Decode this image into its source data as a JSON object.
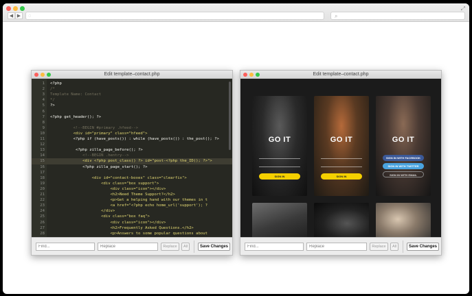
{
  "browser": {
    "back_icon": "back-arrow-icon",
    "forward_icon": "forward-arrow-icon",
    "back_glyph": "◀",
    "forward_glyph": "▶",
    "url_value": "",
    "search_value": ""
  },
  "editor_left": {
    "title": "Edit template–contact.php",
    "highlight_line": 15,
    "lines": [
      {
        "n": "1",
        "t": "<?php"
      },
      {
        "n": "2",
        "t": "/*"
      },
      {
        "n": "3",
        "t": "Template Name: Contact"
      },
      {
        "n": "4",
        "t": "*/"
      },
      {
        "n": "5",
        "t": "?>"
      },
      {
        "n": "6",
        "t": ""
      },
      {
        "n": "7",
        "t": "<?php get_header(); ?>"
      },
      {
        "n": "8",
        "t": ""
      },
      {
        "n": "9",
        "t": "          <!--BEGIN #primary .hfeed-->"
      },
      {
        "n": "10",
        "t": "          <div id=\"primary\" class=\"hfeed\">"
      },
      {
        "n": "11",
        "t": "          <?php if (have_posts()) : while (have_posts()) : the_post(); ?>"
      },
      {
        "n": "12",
        "t": ""
      },
      {
        "n": "13",
        "t": "           <?php zilla_page_before(); ?>"
      },
      {
        "n": "14",
        "t": "              <!--BEGIN .hentry-->"
      },
      {
        "n": "15",
        "t": "              <div <?php post_class() ?> id=\"post-<?php the_ID(); ?>\">"
      },
      {
        "n": "16",
        "t": "              <?php zilla_page_start(); ?>"
      },
      {
        "n": "17",
        "t": ""
      },
      {
        "n": "18",
        "t": "                  <div id=\"contact-boxes\" class=\"clearfix\">"
      },
      {
        "n": "19",
        "t": "                      <div class=\"box support\">"
      },
      {
        "n": "20",
        "t": "                          <div class=\"icon\"></div>"
      },
      {
        "n": "21",
        "t": "                          <h2>Need Theme Support?</h2>"
      },
      {
        "n": "22",
        "t": "                          <p>Get a helping hand with our themes in t"
      },
      {
        "n": "23",
        "t": "                          <a href=\"<?php echo home_url('support'); ?"
      },
      {
        "n": "24",
        "t": "                      </div>"
      },
      {
        "n": "25",
        "t": "                      <div class=\"box faq\">"
      },
      {
        "n": "26",
        "t": "                          <div class=\"icon\"></div>"
      },
      {
        "n": "27",
        "t": "                          <h2>Frequently Asked Questions.</h2>"
      },
      {
        "n": "28",
        "t": "                          <p>Answers to some popular questions about"
      }
    ]
  },
  "editor_right": {
    "title": "Edit template–contact.php",
    "cards": [
      {
        "heading": "GO IT",
        "button": "SIGN IN",
        "theme": "yellow"
      },
      {
        "heading": "GO IT",
        "button": "SIGN IN",
        "theme": "yellow"
      },
      {
        "heading": "GO IT",
        "button": "SIGN IN WITH FACEBOOK",
        "theme": "blue"
      }
    ],
    "card3_buttons": [
      "SIGN IN WITH FACEBOOK",
      "SIGN IN WITH TWITTER",
      "SIGN IN WITH EMAIL"
    ]
  },
  "findbar": {
    "find_placeholder": "Find...",
    "replace_placeholder": "Replace",
    "replace_button": "Replace",
    "all_button": "All",
    "save_button": "Save Changes"
  }
}
